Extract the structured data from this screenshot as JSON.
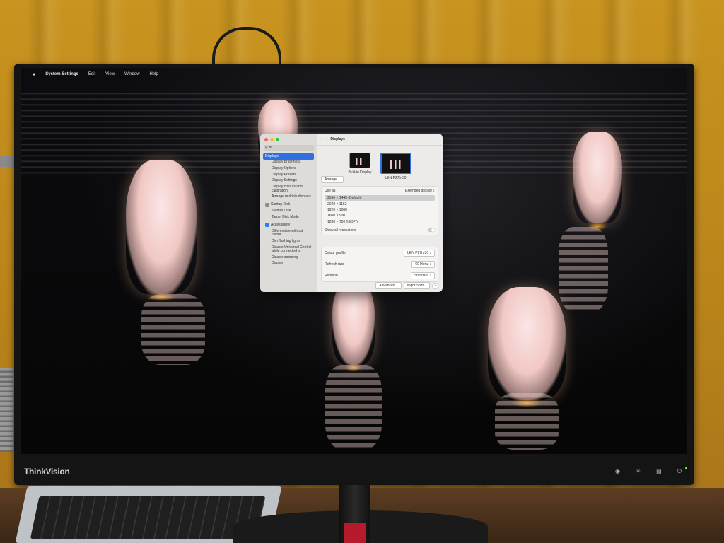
{
  "menubar": {
    "apple_icon": "apple-logo-icon",
    "app_name": "System Settings",
    "items": [
      "Edit",
      "View",
      "Window",
      "Help"
    ]
  },
  "settings": {
    "title": "Displays",
    "search": {
      "value": "di"
    },
    "sidebar": {
      "items": [
        {
          "label": "Displays",
          "kind": "selected"
        },
        {
          "label": "Display Brightness",
          "kind": "sub"
        },
        {
          "label": "Display Options",
          "kind": "sub"
        },
        {
          "label": "Display Presets",
          "kind": "sub"
        },
        {
          "label": "Display Settings",
          "kind": "sub"
        },
        {
          "label": "Display colours and calibration",
          "kind": "sub"
        },
        {
          "label": "Arrange multiple displays",
          "kind": "sub"
        },
        {
          "label": "Startup Disk",
          "kind": "header"
        },
        {
          "label": "Startup Disk",
          "kind": "sub"
        },
        {
          "label": "Target Disk Mode",
          "kind": "sub"
        },
        {
          "label": "Accessibility",
          "kind": "header"
        },
        {
          "label": "Differentiate without colour",
          "kind": "sub"
        },
        {
          "label": "Dim flashing lights",
          "kind": "sub"
        },
        {
          "label": "Disable Universal Control while connected to",
          "kind": "sub"
        },
        {
          "label": "Disable zooming",
          "kind": "sub"
        },
        {
          "label": "Display",
          "kind": "sub"
        }
      ]
    },
    "displays": [
      {
        "name": "Built-in Display",
        "selected": false
      },
      {
        "name": "LEN P27h-30",
        "selected": true
      }
    ],
    "arrange_label": "Arrange...",
    "use_as_label": "Use as",
    "use_as_value": "Extended display",
    "resolutions": [
      "2560 × 1440 (Default)",
      "2048 × 1152",
      "1920 × 1080",
      "1600 × 900",
      "1280 × 720 (HiDPI)"
    ],
    "selected_resolution_index": 0,
    "show_all_label": "Show all resolutions",
    "colour_profile_label": "Colour profile",
    "colour_profile_value": "LEN P27h-30",
    "refresh_rate_label": "Refresh rate",
    "refresh_rate_value": "60 Hertz",
    "rotation_label": "Rotation",
    "rotation_value": "Standard",
    "advanced_label": "Advanced...",
    "night_shift_label": "Night Shift...",
    "help_label": "?"
  },
  "monitor": {
    "brand": "ThinkVision"
  },
  "colors": {
    "accent": "#2f6fe0",
    "curtain": "#c9941f",
    "figure_glow": "#f1c8c4"
  }
}
